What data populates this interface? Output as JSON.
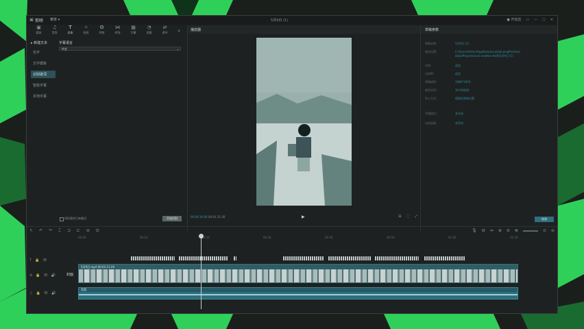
{
  "app": {
    "logo": "剪映",
    "menu": "菜单 ▾",
    "title": "5月9日 (1)",
    "status": "● 开始剪",
    "window_controls": [
      "▭",
      "—",
      "▢",
      "✕"
    ]
  },
  "toolbar": {
    "tools": [
      {
        "icon": "▣",
        "label": "媒体"
      },
      {
        "icon": "♫",
        "label": "音频"
      },
      {
        "icon": "T",
        "label": "文本"
      },
      {
        "icon": "✧",
        "label": "贴纸"
      },
      {
        "icon": "✪",
        "label": "特效"
      },
      {
        "icon": "⋈",
        "label": "转场"
      },
      {
        "icon": "▦",
        "label": "字幕"
      },
      {
        "icon": "◔",
        "label": "滤镜"
      },
      {
        "icon": "⇄",
        "label": "调节"
      }
    ],
    "expand": "»"
  },
  "sidebar": {
    "header": "▸ 新建文本",
    "items": [
      "花字",
      "文字模板",
      "识别歌词",
      "智能字幕",
      "本地字幕"
    ]
  },
  "left_panel": {
    "label": "字幕语言",
    "select_value": "中文",
    "checkbox_label": "同时清空已有歌词",
    "start_button": "开始识别"
  },
  "player": {
    "title": "播放器",
    "current_time": "00:00:10:06",
    "total_time": "00:01:11:26",
    "play": "▶",
    "controls": [
      "⊞",
      "⛶",
      "⤢"
    ]
  },
  "properties": {
    "title": "草稿参数",
    "rows": [
      {
        "key": "草稿名称：",
        "value": "5月9日 (1)"
      },
      {
        "key": "保存位置：",
        "value": "C:/Users/Admin/AppData/Local/JianyingPro/User Data/Projects/com.lveditor.draft/5月9日 (1)"
      },
      {
        "key": "比例：",
        "value": "适应"
      },
      {
        "key": "分辨率：",
        "value": "适应"
      },
      {
        "key": "草稿帧率：",
        "value": "1080*1920"
      },
      {
        "key": "颜色空间：",
        "value": "30.00帧/秒"
      },
      {
        "key": "导入方式：",
        "value": "保留在原有位置"
      },
      {
        "key": "代理模式：",
        "value": "未开启"
      },
      {
        "key": "自由层级：",
        "value": "未开启"
      }
    ],
    "edit_button": "修改"
  },
  "timeline": {
    "left_tools": [
      "↖",
      "↶",
      "↷",
      "⌶",
      "⊐",
      "⊏",
      "⊖",
      "⊡"
    ],
    "right_tools": [
      "🎙",
      "⊟",
      "⇔",
      "⊕",
      "⊘",
      "⊗",
      "⊙",
      "⊖"
    ],
    "ruler": [
      "00:00",
      "00:10",
      "00:20",
      "00:30",
      "00:40",
      "00:50",
      "01:00",
      "01:10"
    ],
    "tracks": {
      "text_icons": [
        "T",
        "🔒",
        "👁"
      ],
      "video_icons": [
        "⊞",
        "🔒",
        "👁",
        "🔊"
      ],
      "audio_icons": [
        "♫",
        "🔒",
        "👁",
        "🔊"
      ]
    },
    "cover_label": "封面",
    "video_clip_name": "5月9日.mp4  00:01:11:26",
    "audio_clip_name": "音频"
  },
  "colors": {
    "accent": "#2f9fb3",
    "background_green": "#2fd05a",
    "video_clip": "#6f9aa3",
    "audio_clip": "#2d6f7d"
  }
}
